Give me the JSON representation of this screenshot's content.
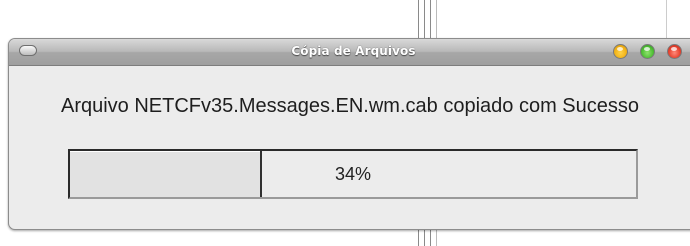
{
  "window": {
    "title": "Cópia de Arquivos",
    "controls": {
      "menu_icon": "window-menu-icon",
      "minimize_icon": "minimize-icon",
      "maximize_icon": "maximize-icon",
      "close_icon": "close-icon",
      "colors": {
        "minimize": "#f2b318",
        "maximize": "#4fbf36",
        "close": "#e8432f"
      }
    }
  },
  "message": "Arquivo NETCFv35.Messages.EN.wm.cab copiado com Sucesso",
  "progress": {
    "percent": 34,
    "label": "34%"
  }
}
